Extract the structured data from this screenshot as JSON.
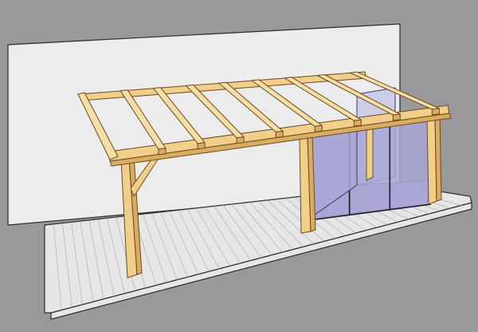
{
  "scene": {
    "background_color": "#999999",
    "wall_color": "#ececec",
    "floor_color": "#e6e6e6",
    "timber_color": "#f1cf8a",
    "glass_color": "#a8a6d6",
    "rafter_count": 8,
    "floor_board_count": 40,
    "door_panel_count": 3
  }
}
